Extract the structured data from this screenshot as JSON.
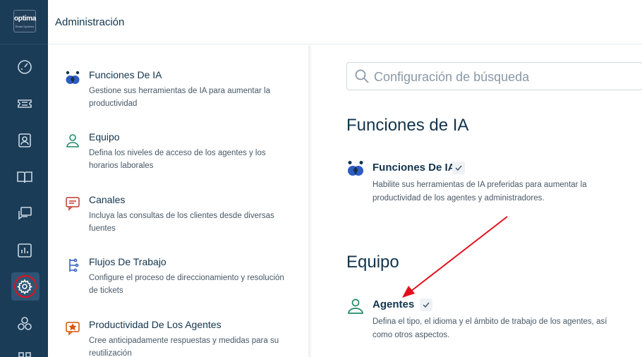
{
  "app": {
    "logo_text": "optima",
    "logo_subtext": "Retail Systems"
  },
  "colors": {
    "rail_bg": "#1b3c57",
    "rail_active": "#2e5575",
    "text_primary": "#12344d",
    "text_secondary": "#475867",
    "ring_highlight": "#e3101c",
    "arrow": "#e3101c",
    "ai_icon_blue": "#2c5cc5"
  },
  "sidebar": {
    "items": [
      {
        "icon": "dashboard-gauge-icon"
      },
      {
        "icon": "tickets-icon"
      },
      {
        "icon": "contacts-icon"
      },
      {
        "icon": "knowledge-base-book-icon"
      },
      {
        "icon": "conversations-icon"
      },
      {
        "icon": "reports-chart-icon"
      },
      {
        "icon": "settings-gear-icon",
        "active": true
      },
      {
        "icon": "apps-hexagons-icon"
      },
      {
        "icon": "grid-icon"
      }
    ]
  },
  "header": {
    "title": "Administración"
  },
  "left_panel": {
    "items": [
      {
        "icon": "ai-features-icon",
        "title": "Funciones De IA",
        "description": "Gestione sus herramientas de IA para aumentar la productividad"
      },
      {
        "icon": "team-person-icon",
        "title": "Equipo",
        "description": "Defina los niveles de acceso de los agentes y los horarios laborales"
      },
      {
        "icon": "channels-chat-icon",
        "title": "Canales",
        "description": "Incluya las consultas de los clientes desde diversas fuentes"
      },
      {
        "icon": "workflow-icon",
        "title": "Flujos De Trabajo",
        "description": "Configure el proceso de direccionamiento y resolución de tickets"
      },
      {
        "icon": "agent-productivity-icon",
        "title": "Productividad De Los Agentes",
        "description": "Cree anticipadamente respuestas y medidas para su reutilización"
      }
    ]
  },
  "right_panel": {
    "search": {
      "placeholder": "Configuración de búsqueda"
    },
    "sections": [
      {
        "heading": "Funciones de IA",
        "feature": {
          "icon": "ai-features-icon",
          "title": "Funciones De IA",
          "description": "Habilite sus herramientas de IA preferidas para aumentar la productividad de los agentes y administradores."
        }
      },
      {
        "heading": "Equipo",
        "feature": {
          "icon": "agents-person-icon",
          "title": "Agentes",
          "description": "Defina el tipo, el idioma y el ámbito de trabajo de los agentes, así como otros aspectos."
        }
      }
    ]
  }
}
